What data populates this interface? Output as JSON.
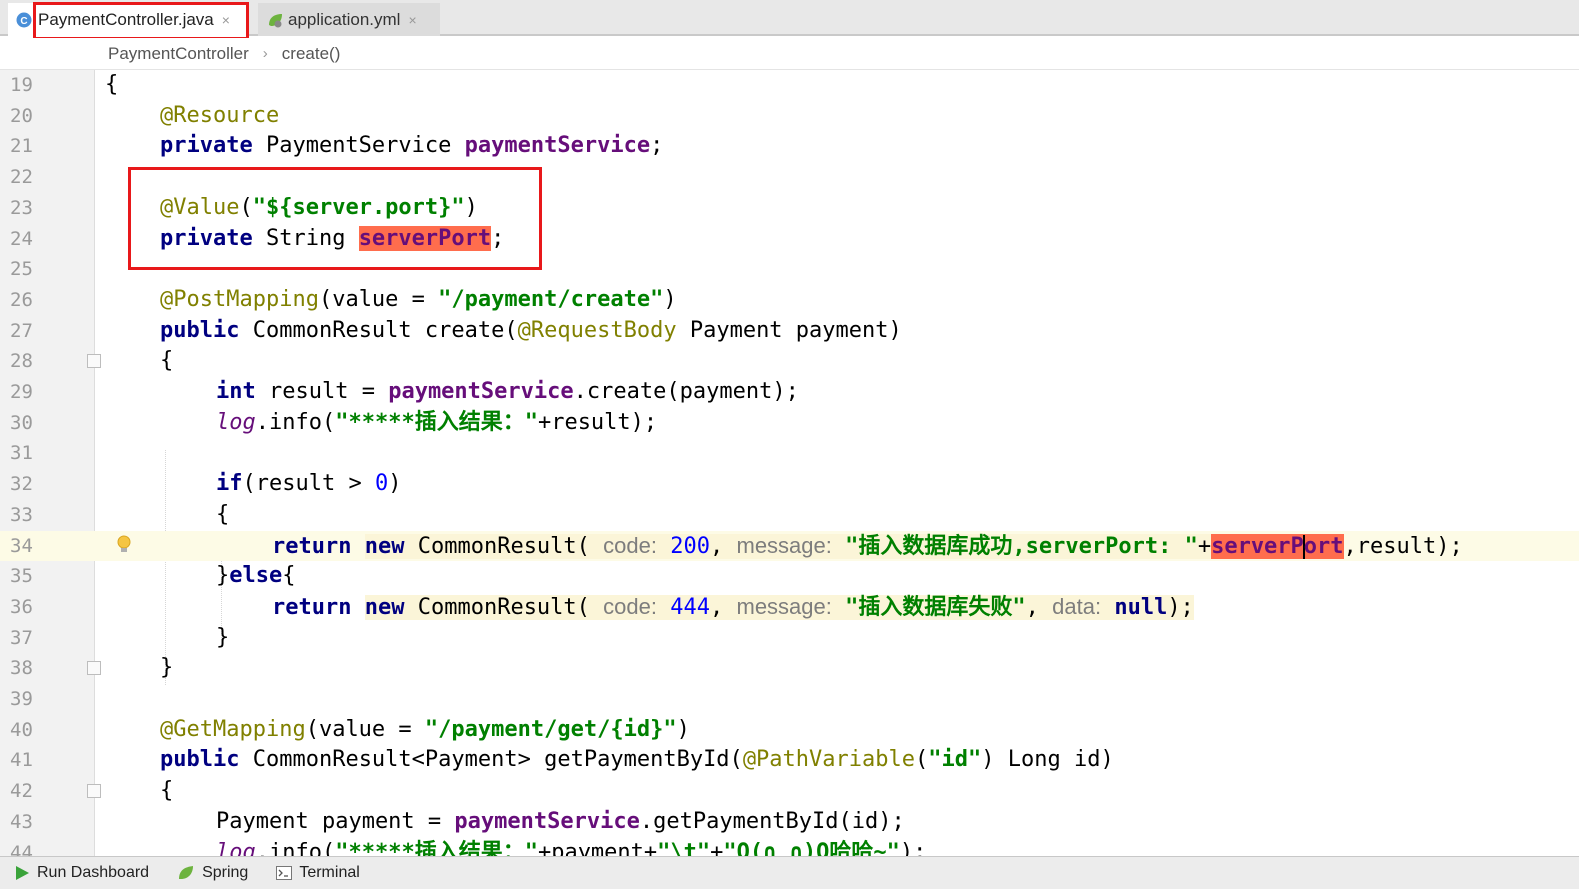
{
  "tabs": [
    {
      "label": "PaymentController.java",
      "icon": "class-c-icon",
      "active": true
    },
    {
      "label": "application.yml",
      "icon": "spring-leaf-icon",
      "active": false
    }
  ],
  "close_glyph": "×",
  "breadcrumb": {
    "class": "PaymentController",
    "sep": "›",
    "method": "create()"
  },
  "lines": {
    "n19": "19",
    "n20": "20",
    "n21": "21",
    "n22": "22",
    "n23": "23",
    "n24": "24",
    "n25": "25",
    "n26": "26",
    "n27": "27",
    "n28": "28",
    "n29": "29",
    "n30": "30",
    "n31": "31",
    "n32": "32",
    "n33": "33",
    "n34": "34",
    "n35": "35",
    "n36": "36",
    "n37": "37",
    "n38": "38",
    "n39": "39",
    "n40": "40",
    "n41": "41",
    "n42": "42",
    "n43": "43",
    "n44": "44"
  },
  "code": {
    "l19": {
      "t1": "{"
    },
    "l20": {
      "t1": "@Resource"
    },
    "l21": {
      "t1": "private",
      "t2": " PaymentService ",
      "t3": "paymentService",
      "t4": ";"
    },
    "l23": {
      "t1": "@Value",
      "t2": "(",
      "t3": "\"${server.port}\"",
      "t4": ")"
    },
    "l24": {
      "t1": "private",
      "t2": " String ",
      "t3": "serverPort",
      "t4": ";"
    },
    "l26": {
      "t1": "@PostMapping",
      "t2": "(value = ",
      "t3": "\"/payment/create\"",
      "t4": ")"
    },
    "l27": {
      "t1": "public",
      "t2": " CommonResult create(",
      "t3": "@RequestBody",
      "t4": " Payment payment)"
    },
    "l28": {
      "t1": "{"
    },
    "l29": {
      "t1": "int",
      "t2": " result = ",
      "t3": "paymentService",
      "t4": ".create(payment);"
    },
    "l30": {
      "t1": "log",
      "t2": ".info(",
      "t3": "\"*****插入结果：\"",
      "t4": "+result);"
    },
    "l32": {
      "t1": "if",
      "t2": "(result > ",
      "t3": "0",
      "t4": ")"
    },
    "l33": {
      "t1": "{"
    },
    "l34": {
      "t1": "return",
      "t2": " ",
      "t3": "new",
      "t4": " CommonResult( ",
      "h1": "code:",
      "t5": " ",
      "t6": "200",
      "t7": ", ",
      "h2": "message:",
      "t8": " ",
      "t9": "\"插入数据库成功,serverPort: \"",
      "t10": "+",
      "t11a": "serverP",
      "t11b": "ort",
      "t12": ",result);"
    },
    "l35": {
      "t1": "}",
      "t2": "else",
      "t3": "{"
    },
    "l36": {
      "t1": "return",
      "t2": " ",
      "t3": "new",
      "t4": " CommonResult( ",
      "h1": "code:",
      "t5": " ",
      "t6": "444",
      "t7": ", ",
      "h2": "message:",
      "t8": " ",
      "t9": "\"插入数据库失败\"",
      "t10": ", ",
      "h3": "data:",
      "t11": " ",
      "t12": "null",
      "t13": ");"
    },
    "l37": {
      "t1": "}"
    },
    "l38": {
      "t1": "}"
    },
    "l40": {
      "t1": "@GetMapping",
      "t2": "(value = ",
      "t3": "\"/payment/get/{id}\"",
      "t4": ")"
    },
    "l41": {
      "t1": "public",
      "t2": " CommonResult<Payment> getPaymentById(",
      "t3": "@PathVariable",
      "t4": "(",
      "t5": "\"id\"",
      "t6": ") Long id)"
    },
    "l42": {
      "t1": "{"
    },
    "l43": {
      "t1": "Payment payment = ",
      "t2": "paymentService",
      "t3": ".getPaymentById(id);"
    },
    "l44": {
      "t1": "log",
      "t2": ".info(",
      "t3": "\"*****插入结果：\"",
      "t4": "+payment+",
      "t5": "\"\\t\"",
      "t6": "+",
      "t7": "\"O(∩_∩)O哈哈~\"",
      "t8": ");"
    }
  },
  "statusbar": [
    {
      "label": "Run Dashboard",
      "icon": "run-icon"
    },
    {
      "label": "Spring",
      "icon": "spring-leaf-icon"
    },
    {
      "label": "Terminal",
      "icon": "terminal-icon"
    }
  ],
  "colors": {
    "highlight": "#ff6d4d",
    "annotation_box": "#e8181a",
    "keyword": "#000080",
    "string": "#008000"
  }
}
